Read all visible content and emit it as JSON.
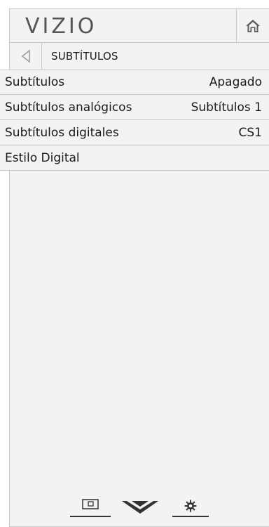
{
  "header": {
    "logo_text": "VIZIO",
    "home_icon": "home-icon"
  },
  "titlebar": {
    "back_icon": "back-arrow-icon",
    "title": "SUBTÍTULOS"
  },
  "menu": {
    "items": [
      {
        "label": "Subtítulos",
        "value": "Apagado"
      },
      {
        "label": "Subtítulos analógicos",
        "value": "Subtítulos 1"
      },
      {
        "label": "Subtítulos digitales",
        "value": "CS1"
      },
      {
        "label": "Estilo Digital",
        "value": ""
      }
    ]
  },
  "toolbar": {
    "items": [
      {
        "icon": "picture-input-icon"
      },
      {
        "icon": "vizio-v-icon"
      },
      {
        "icon": "settings-gear-icon"
      }
    ]
  },
  "colors": {
    "panel_bg": "#f3f3f3",
    "divider": "#c8c8c8",
    "text": "#1a1a1a",
    "logo": "#555555"
  }
}
